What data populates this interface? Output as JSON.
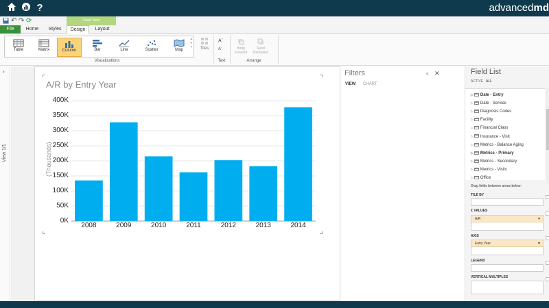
{
  "brand": {
    "prefix": "advanced",
    "suffix": "md"
  },
  "ribbon": {
    "contextual_header": "Chart Tools",
    "tabs": [
      "File",
      "Home",
      "Styles",
      "Design",
      "Layout"
    ],
    "visualizations": [
      "Table",
      "Matrix",
      "Column",
      "Bar",
      "Line",
      "Scatter",
      "Map"
    ],
    "active_visualization": "Column",
    "tiles_label": "Tiles",
    "group_visualizations": "Visualizations",
    "group_text": "Text",
    "group_arrange": "Arrange",
    "bring_forward": "Bring Forward",
    "send_backward": "Send Backward"
  },
  "left_pane": {
    "label": "View 1/1",
    "chevron": "›"
  },
  "chart_data": {
    "type": "bar",
    "title": "A/R by Entry Year",
    "ylabel": "(Thousands)",
    "xlabel": "",
    "categories": [
      "2008",
      "2009",
      "2010",
      "2011",
      "2012",
      "2013",
      "2014"
    ],
    "values": [
      135,
      328,
      215,
      162,
      202,
      182,
      378
    ],
    "ylim": [
      0,
      400
    ],
    "yticks": [
      "0K",
      "50K",
      "100K",
      "150K",
      "200K",
      "250K",
      "300K",
      "350K",
      "400K"
    ],
    "color": "#00aeef",
    "grid": true
  },
  "filters": {
    "title": "Filters",
    "tab_view": "VIEW",
    "tab_chart": "CHART"
  },
  "field_list": {
    "title": "Field List",
    "tab_active": "ACTIVE",
    "tab_all": "ALL",
    "items": [
      {
        "label": "Date - Entry",
        "bold": true
      },
      {
        "label": "Date - Service",
        "bold": false
      },
      {
        "label": "Diagnosis Codes",
        "bold": false
      },
      {
        "label": "Facility",
        "bold": false
      },
      {
        "label": "Financial Class",
        "bold": false
      },
      {
        "label": "Insurance - Visit",
        "bold": false
      },
      {
        "label": "Metrics - Balance Aging",
        "bold": false
      },
      {
        "label": "Metrics - Primary",
        "bold": true
      },
      {
        "label": "Metrics - Secondary",
        "bold": false
      },
      {
        "label": "Metrics - Visits",
        "bold": false
      },
      {
        "label": "Office",
        "bold": false
      }
    ],
    "drag_hint": "Drag fields between areas below:",
    "tile_by": "TILE BY",
    "values_hdr": "Σ VALUES",
    "values_field": "A/R",
    "axis_hdr": "AXIS",
    "axis_field": "Entry Year",
    "legend_hdr": "LEGEND",
    "vmult_hdr": "VERTICAL MULTIPLES"
  }
}
